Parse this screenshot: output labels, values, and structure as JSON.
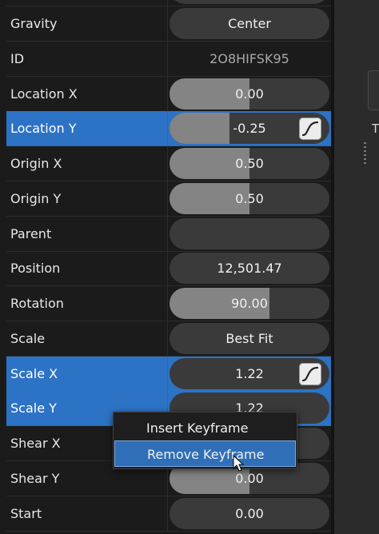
{
  "rows": [
    {
      "label": "Gravity",
      "value": "Center",
      "fill": null,
      "selected": false
    },
    {
      "label": "ID",
      "value": "2O8HIFSK95",
      "fill": null,
      "selected": false,
      "readonly": true
    },
    {
      "label": "Location X",
      "value": "0.00",
      "fill": 0.5,
      "selected": false
    },
    {
      "label": "Location Y",
      "value": "-0.25",
      "fill": 0.375,
      "selected": true,
      "keyframe_icon": "curve-icon"
    },
    {
      "label": "Origin X",
      "value": "0.50",
      "fill": 0.5,
      "selected": false
    },
    {
      "label": "Origin Y",
      "value": "0.50",
      "fill": 0.5,
      "selected": false
    },
    {
      "label": "Parent",
      "value": "",
      "fill": null,
      "selected": false
    },
    {
      "label": "Position",
      "value": "12,501.47",
      "fill": null,
      "selected": false
    },
    {
      "label": "Rotation",
      "value": "90.00",
      "fill": 0.625,
      "selected": false
    },
    {
      "label": "Scale",
      "value": "Best Fit",
      "fill": null,
      "selected": false
    },
    {
      "label": "Scale X",
      "value": "1.22",
      "fill": null,
      "selected": true,
      "keyframe_icon": "curve-icon"
    },
    {
      "label": "Scale Y",
      "value": "1.22",
      "fill": null,
      "selected": true
    },
    {
      "label": "Shear X",
      "value": "",
      "fill": null,
      "selected": false
    },
    {
      "label": "Shear Y",
      "value": "0.00",
      "fill": 0.5,
      "selected": false
    },
    {
      "label": "Start",
      "value": "0.00",
      "fill": null,
      "selected": false
    }
  ],
  "context_menu": {
    "items": [
      {
        "label": "Insert Keyframe",
        "hover": false
      },
      {
        "label": "Remove Keyframe",
        "hover": true
      }
    ]
  },
  "right_panel": {
    "letter": "T"
  },
  "colors": {
    "selection": "#2d73c5",
    "menu_hover": "#2f6fb7",
    "slider_fill": "#848484",
    "pill": "#3a3a3a"
  }
}
